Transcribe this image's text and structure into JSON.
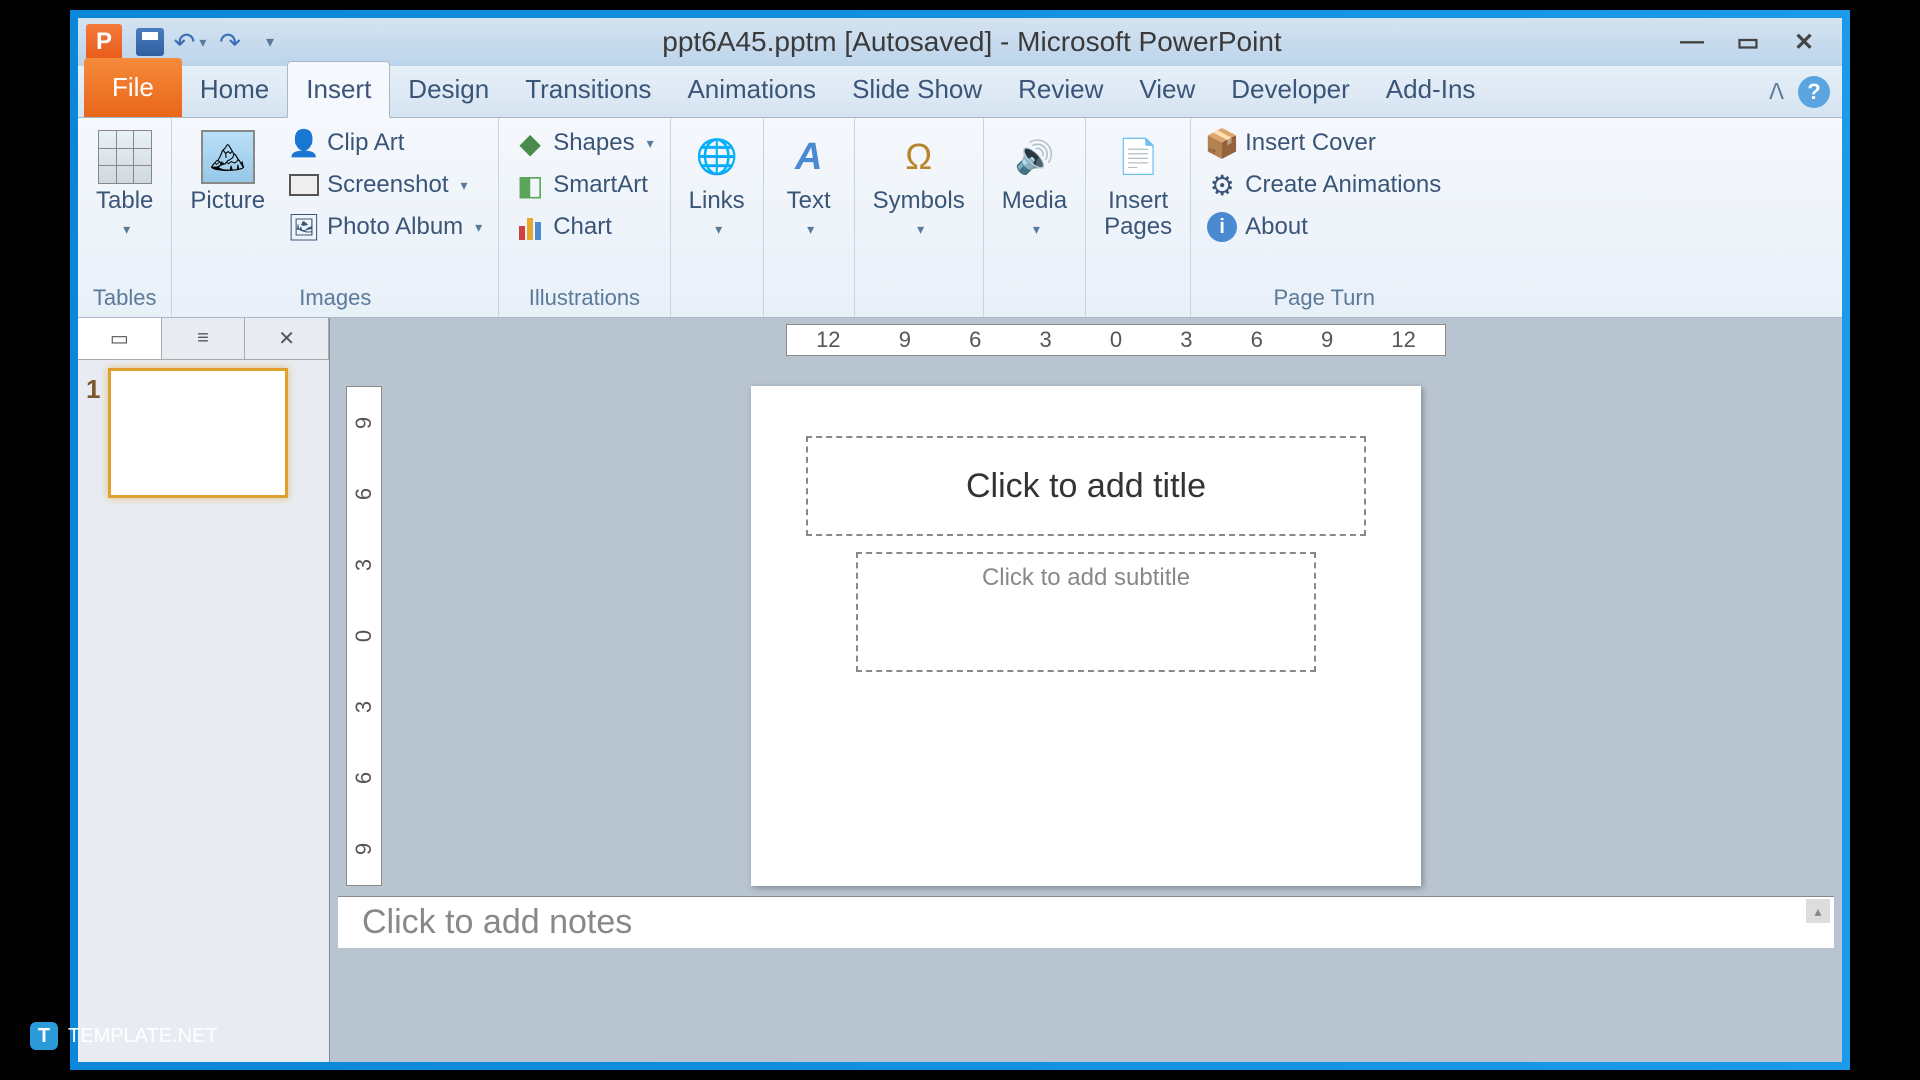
{
  "titlebar": {
    "app_letter": "P",
    "title": "ppt6A45.pptm [Autosaved] - Microsoft PowerPoint"
  },
  "tabs": {
    "file": "File",
    "home": "Home",
    "insert": "Insert",
    "design": "Design",
    "transitions": "Transitions",
    "animations": "Animations",
    "slideshow": "Slide Show",
    "review": "Review",
    "view": "View",
    "developer": "Developer",
    "addins": "Add-Ins"
  },
  "ribbon": {
    "tables": {
      "label": "Tables",
      "table": "Table"
    },
    "images": {
      "label": "Images",
      "picture": "Picture",
      "clipart": "Clip Art",
      "screenshot": "Screenshot",
      "photoalbum": "Photo Album"
    },
    "illustrations": {
      "label": "Illustrations",
      "shapes": "Shapes",
      "smartart": "SmartArt",
      "chart": "Chart"
    },
    "links": "Links",
    "text": "Text",
    "symbols": "Symbols",
    "media": "Media",
    "insertpages": "Insert\nPages",
    "pageturn": {
      "label": "Page Turn",
      "cover": "Insert Cover",
      "anim": "Create Animations",
      "about": "About"
    }
  },
  "ruler_h": [
    "12",
    "9",
    "6",
    "3",
    "0",
    "3",
    "6",
    "9",
    "12"
  ],
  "ruler_v": [
    "9",
    "6",
    "3",
    "0",
    "3",
    "6",
    "9"
  ],
  "thumbnails": {
    "slide1": "1"
  },
  "slide": {
    "title_placeholder": "Click to add title",
    "subtitle_placeholder": "Click to add subtitle"
  },
  "notes_placeholder": "Click to add notes",
  "watermark": "TEMPLATE.NET"
}
